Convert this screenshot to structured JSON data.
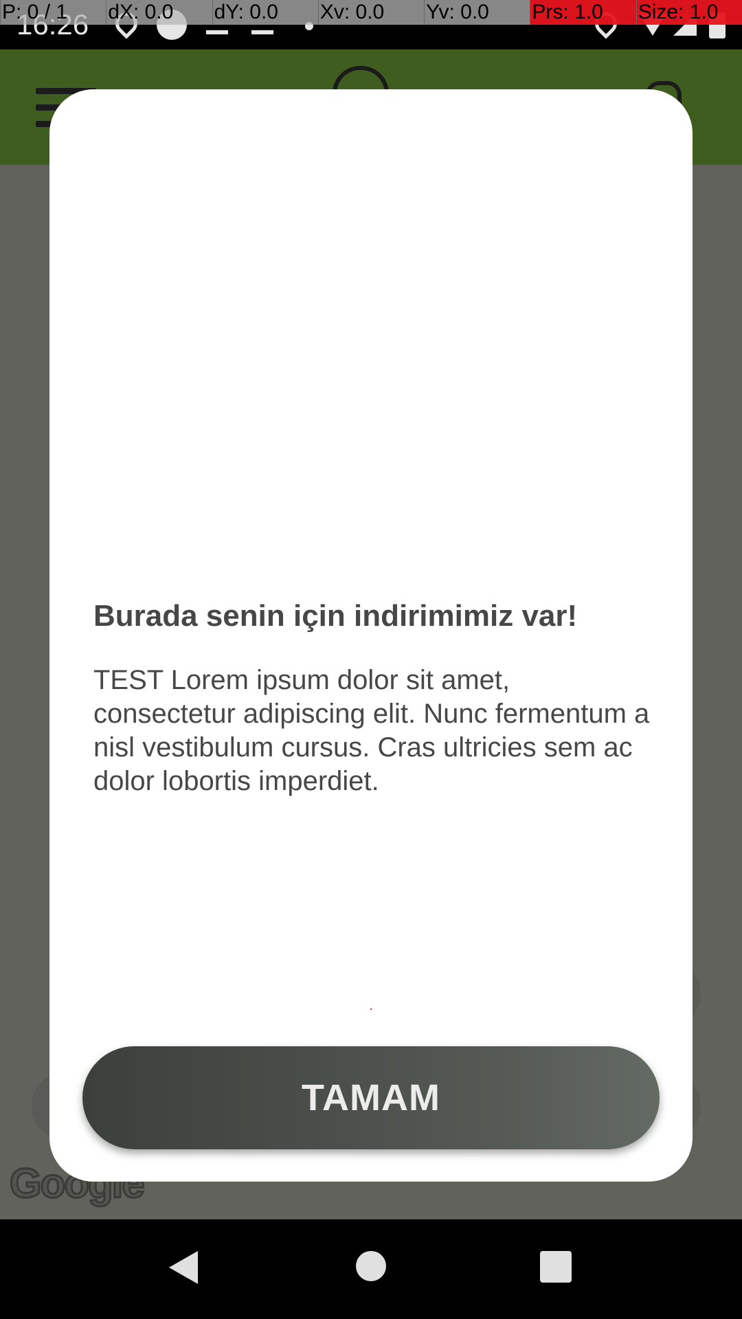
{
  "status_bar": {
    "time": "16:26",
    "icons": [
      "location-icon",
      "sync-icon",
      "download-icon",
      "download-icon",
      "dot-icon",
      "pin-icon",
      "wifi-icon",
      "signal-icon",
      "battery-icon"
    ]
  },
  "debug_overlay": {
    "cells": [
      "P: 0 / 1",
      "dX: 0.0",
      "dY: 0.0",
      "Xv: 0.0",
      "Yv: 0.0",
      "Prs: 1.0",
      "Size: 1.0"
    ]
  },
  "background": {
    "header_color": "#3f5d1e",
    "map_attribution": "Google"
  },
  "dialog": {
    "title": "Burada senin için indirimimiz var!",
    "body": "TEST Lorem ipsum dolor sit amet, consectetur adipiscing elit. Nunc fermentum a nisl vestibulum cursus. Cras ultricies sem ac dolor lobortis imperdiet.",
    "button_label": "TAMAM"
  },
  "nav_bar": {
    "icons": [
      "back-icon",
      "home-icon",
      "recents-icon"
    ]
  }
}
